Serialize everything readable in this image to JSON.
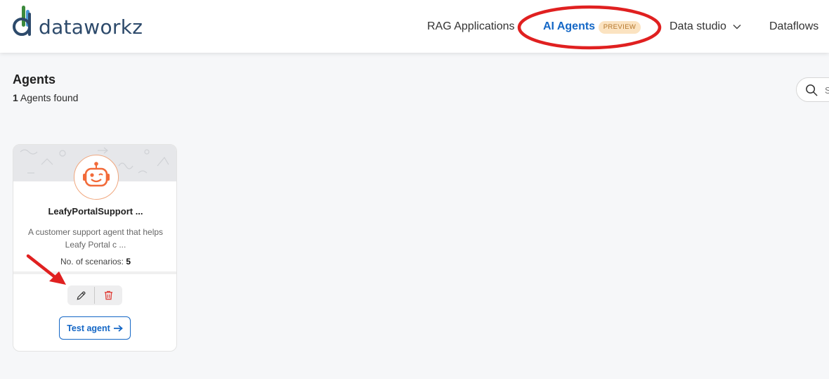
{
  "brand": {
    "logo_text": "dataworkz"
  },
  "nav": {
    "rag": "RAG Applications",
    "agents": "AI Agents",
    "preview_badge": "PREVIEW",
    "studio": "Data studio",
    "dataflows": "Dataflows"
  },
  "page": {
    "title": "Agents",
    "count": "1",
    "count_suffix": " Agents found",
    "search_placeholder": "S"
  },
  "agent_card": {
    "name": "LeafyPortalSupport ...",
    "description": "A customer support agent that helps Leafy Portal c ...",
    "scenarios_label": "No. of scenarios:",
    "scenarios_value": "5",
    "test_label": "Test agent"
  },
  "colors": {
    "accent": "#1467c6",
    "annotation": "#e02020",
    "agent_icon": "#f26b3a",
    "delete": "#e0403a"
  },
  "icons": [
    "logo-mark-icon",
    "chevron-down-icon",
    "search-icon",
    "robot-icon",
    "pencil-icon",
    "trash-icon",
    "arrow-right-icon"
  ]
}
